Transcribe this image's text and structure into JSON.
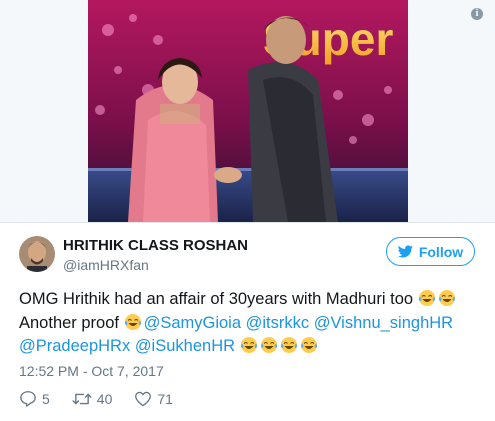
{
  "tweet": {
    "author": {
      "display_name": "HRITHIK CLASS ROSHAN",
      "handle": "@iamHRXfan"
    },
    "follow_label": "Follow",
    "text": {
      "part1": "OMG Hrithik had an affair of 30years with Madhuri too ",
      "part2": "Another proof ",
      "mentions": [
        "@SamyGioia",
        "@itsrkkc",
        "@Vishnu_singhHR",
        "@PradeepHRx",
        "@iSukhenHR"
      ]
    },
    "timestamp": "12:52 PM - Oct 7, 2017",
    "stats": {
      "replies": "5",
      "retweets": "40",
      "likes": "71"
    },
    "photo": {
      "sign_text": "Super"
    }
  },
  "colors": {
    "link": "#1b95e0",
    "follow_blue": "#1da1f2",
    "secondary_text": "#657786",
    "primary_text": "#14171a"
  },
  "icons": [
    "info-icon",
    "twitter-bird-icon",
    "reply-icon",
    "retweet-icon",
    "like-icon",
    "tears-of-joy-emoji"
  ]
}
